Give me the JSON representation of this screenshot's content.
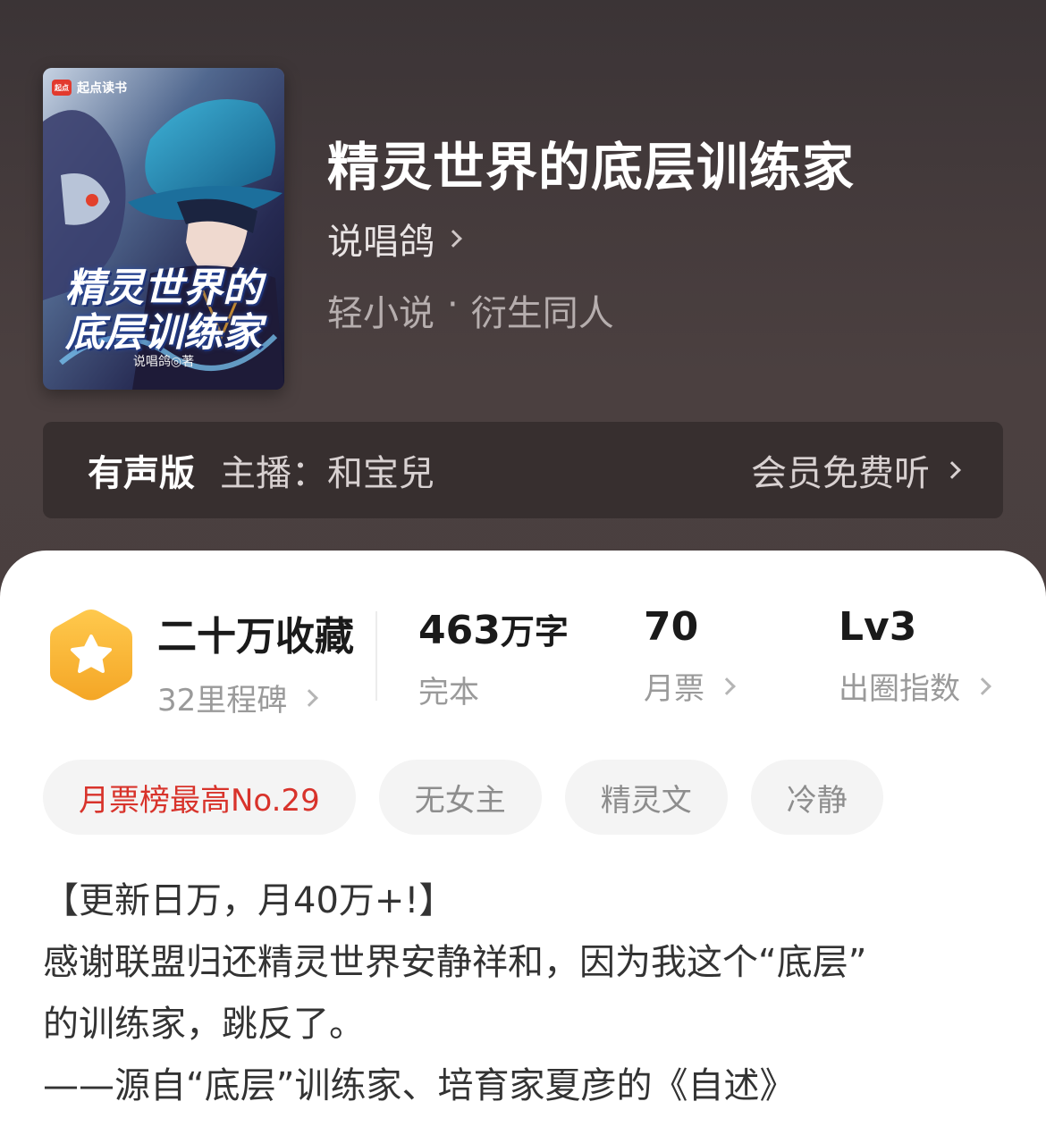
{
  "book": {
    "title": "精灵世界的底层训练家",
    "author": "说唱鸽",
    "genre": "轻小说",
    "subgenre": "衍生同人",
    "genre_separator": "·",
    "cover": {
      "brand": "起点读书",
      "brand_logo": "起点",
      "title_line1": "精灵世界的",
      "title_line2": "底层训练家",
      "author_text": "说唱鸽◎著"
    }
  },
  "audio": {
    "tag": "有声版",
    "host": "主播：和宝兒",
    "cta": "会员免费听"
  },
  "stats": {
    "collect_title": "二十万收藏",
    "collect_sub": "32里程碑",
    "words_number": "463",
    "words_unit": "万字",
    "words_sub": "完本",
    "votes_number": "70",
    "votes_sub": "月票",
    "level_number": "Lv3",
    "level_sub": "出圈指数"
  },
  "tags": [
    "月票榜最高No.29",
    "无女主",
    "精灵文",
    "冷静"
  ],
  "description": {
    "line1": "【更新日万，月40万+!】",
    "line2": "感谢联盟归还精灵世界安静祥和，因为我这个“底层”",
    "line3": "的训练家，跳反了。",
    "line4": "——源自“底层”训练家、培育家夏彦的《自述》"
  },
  "colors": {
    "hot_tag": "#d8332b",
    "badge": "#f5b83a",
    "header_bg": "#453b3c"
  }
}
